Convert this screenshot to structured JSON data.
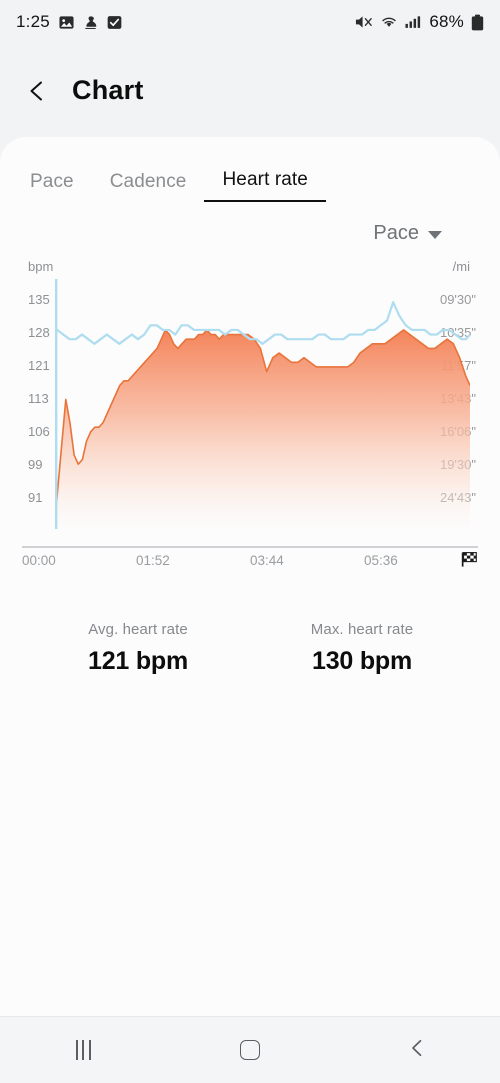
{
  "status_bar": {
    "time": "1:25",
    "left_icons": [
      "photo-icon",
      "sound-off-icon",
      "checkbox-icon"
    ],
    "right_icons": [
      "mute-icon",
      "wifi-icon",
      "signal-icon"
    ],
    "battery_text": "68%",
    "battery_icon": "battery-icon"
  },
  "app_bar": {
    "back_icon": "back-chevron-icon",
    "title": "Chart"
  },
  "tabs": [
    {
      "label": "Pace",
      "active": false
    },
    {
      "label": "Cadence",
      "active": false
    },
    {
      "label": "Heart rate",
      "active": true
    }
  ],
  "metric_selector": {
    "value": "Pace",
    "caret_icon": "chevron-down-icon"
  },
  "stats": [
    {
      "label": "Avg. heart rate",
      "value": "121 bpm"
    },
    {
      "label": "Max. heart rate",
      "value": "130 bpm"
    }
  ],
  "nav_bar": {
    "recents_icon": "recents-icon",
    "home_icon": "home-icon",
    "back_icon": "back-icon"
  },
  "colors": {
    "hr_line": "#E8743B",
    "hr_fill_top": "#F49267",
    "hr_fill_bottom": "#FDF8F6",
    "pace_line": "#AEDDF0",
    "accent_text": "#101010",
    "muted_text": "#8d9094",
    "card_bg": "#fcfcfc",
    "page_bg": "#f2f3f5"
  },
  "chart_data": {
    "type": "area",
    "title": "Heart rate",
    "xlabel": "",
    "ylabel": "bpm",
    "y2label": "/mi",
    "grid": false,
    "legend": "none",
    "x_ticks": [
      "00:00",
      "01:52",
      "03:44",
      "05:36"
    ],
    "x_end_icon": "finish-flag-icon",
    "y_ticks_left": [
      135,
      128,
      121,
      113,
      106,
      99,
      91
    ],
    "y_ticks_right": [
      "09'30\"",
      "10'35\"",
      "11'57\"",
      "13'43\"",
      "16'06\"",
      "19'30\"",
      "24'43\""
    ],
    "ylim": [
      85,
      139
    ],
    "xlim": [
      0,
      100
    ],
    "series": [
      {
        "name": "Heart rate",
        "unit": "bpm",
        "color": "#E8743B",
        "fill": true,
        "x": [
          0.0,
          0.4,
          1.6,
          2.6,
          3.6,
          4.6,
          5.6,
          6.6,
          7.6,
          8.6,
          9.6,
          10.6,
          11.6,
          12.6,
          13.6,
          14.6,
          15.6,
          16.6,
          17.6,
          18.6,
          19.6,
          20.6,
          21.6,
          22.6,
          23.6,
          24.6,
          25.6,
          26.6,
          27.6,
          28.6,
          29.6,
          30.6,
          31.6,
          32.6,
          33.6,
          34.6,
          35.6,
          36.6,
          37.6,
          38.6,
          39.6,
          40.6,
          41.6,
          42.6,
          43.6,
          45.0,
          46.5,
          48.0,
          49.5,
          51.0,
          52.5,
          54.0,
          55.5,
          57.0,
          58.5,
          60.0,
          61.5,
          63.0,
          64.5,
          66.0,
          67.5,
          69.0,
          70.5,
          72.0,
          73.5,
          75.0,
          76.5,
          78.0,
          79.5,
          81.0,
          82.5,
          84.0,
          85.5,
          87.0,
          88.5,
          90.0,
          91.5,
          93.0,
          94.5,
          96.0,
          97.5,
          99.0,
          100.0
        ],
        "values": [
          89,
          91,
          103,
          113,
          108,
          101,
          99,
          100,
          104,
          106,
          107,
          107,
          108,
          110,
          112,
          114,
          116,
          117,
          117,
          118,
          119,
          120,
          121,
          122,
          123,
          124,
          126,
          128,
          127,
          125,
          124,
          125,
          126,
          126,
          126,
          127,
          127,
          128,
          127,
          127,
          126,
          127,
          127,
          127,
          127,
          127,
          127,
          126,
          124,
          119,
          122,
          123,
          122,
          121,
          121,
          122,
          121,
          120,
          120,
          120,
          120,
          120,
          120,
          121,
          123,
          124,
          125,
          125,
          125,
          126,
          127,
          128,
          127,
          126,
          125,
          124,
          124,
          125,
          126,
          125,
          122,
          118,
          116
        ]
      },
      {
        "name": "Pace",
        "unit": "/mi",
        "color": "#AEDDF0",
        "fill": false,
        "x": [
          0.0,
          0.5,
          2.0,
          3.5,
          5.0,
          6.5,
          8.0,
          9.5,
          11.0,
          12.5,
          14.0,
          15.5,
          17.0,
          18.5,
          20.0,
          21.5,
          23.0,
          24.5,
          26.0,
          27.5,
          29.0,
          30.5,
          32.0,
          33.5,
          35.0,
          36.5,
          38.0,
          39.5,
          41.0,
          42.5,
          44.0,
          45.5,
          47.0,
          48.5,
          50.0,
          51.5,
          53.0,
          54.5,
          56.0,
          57.5,
          59.0,
          60.5,
          62.0,
          63.5,
          65.0,
          66.5,
          68.0,
          69.5,
          71.0,
          72.5,
          74.0,
          75.5,
          77.0,
          78.5,
          80.0,
          81.5,
          83.0,
          84.5,
          86.0,
          87.5,
          89.0,
          90.5,
          92.0,
          93.5,
          95.0,
          96.5,
          98.0,
          99.0,
          100.0
        ],
        "values": [
          129,
          128,
          127,
          126,
          126,
          127,
          126,
          125,
          126,
          127,
          126,
          125,
          126,
          127,
          126,
          127,
          129,
          129,
          128,
          128,
          127,
          129,
          129,
          128,
          128,
          128,
          128,
          128,
          127,
          128,
          128,
          127,
          126,
          126,
          125,
          126,
          127,
          127,
          126,
          126,
          126,
          126,
          126,
          127,
          127,
          126,
          126,
          126,
          127,
          127,
          127,
          128,
          128,
          129,
          130,
          134,
          131,
          129,
          128,
          128,
          128,
          127,
          127,
          128,
          128,
          127,
          126,
          126,
          127
        ]
      }
    ],
    "marker_line": {
      "x": 0.0,
      "color": "#AEDDF0",
      "name": "start-marker"
    }
  }
}
